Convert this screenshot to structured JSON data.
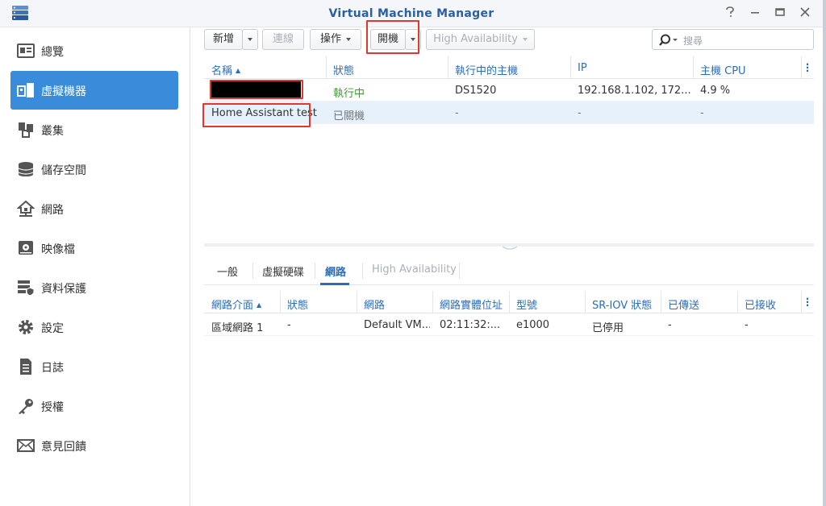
{
  "window": {
    "title": "Virtual Machine Manager"
  },
  "sidebar": {
    "items": [
      {
        "label": "總覽",
        "icon": "overview-icon"
      },
      {
        "label": "虛擬機器",
        "icon": "vm-icon",
        "active": true
      },
      {
        "label": "叢集",
        "icon": "cluster-icon"
      },
      {
        "label": "儲存空間",
        "icon": "storage-icon"
      },
      {
        "label": "網路",
        "icon": "network-icon"
      },
      {
        "label": "映像檔",
        "icon": "image-icon"
      },
      {
        "label": "資料保護",
        "icon": "protection-icon"
      },
      {
        "label": "設定",
        "icon": "gear-icon"
      },
      {
        "label": "日誌",
        "icon": "log-icon"
      },
      {
        "label": "授權",
        "icon": "key-icon"
      },
      {
        "label": "意見回饋",
        "icon": "mail-icon"
      }
    ]
  },
  "toolbar": {
    "create": "新增",
    "connect": "連線",
    "action": "操作",
    "power_on": "開機",
    "high_availability": "High Availability",
    "search_placeholder": "搜尋"
  },
  "vm_table": {
    "columns": [
      "名稱",
      "狀態",
      "執行中的主機",
      "IP",
      "主機 CPU"
    ],
    "rows": [
      {
        "name": "",
        "status": "執行中",
        "host": "DS1520",
        "ip": "192.168.1.102, 172....",
        "cpu": "4.9 %"
      },
      {
        "name": "Home Assistant test",
        "status": "已關機",
        "host": "-",
        "ip": "-",
        "cpu": "-"
      }
    ]
  },
  "detail_tabs": [
    "一般",
    "虛擬硬碟",
    "網路",
    "High Availability"
  ],
  "network_table": {
    "columns": [
      "網路介面",
      "狀態",
      "網路",
      "網路實體位址",
      "型號",
      "SR-IOV 狀態",
      "已傳送",
      "已接收"
    ],
    "rows": [
      {
        "interface": "區域網路 1",
        "status": "-",
        "network": "Default VM...",
        "mac": "02:11:32:...",
        "model": "e1000",
        "sriov": "已停用",
        "sent": "-",
        "received": "-"
      }
    ]
  },
  "colors": {
    "accent": "#3a8bd9",
    "link": "#2a6ebb",
    "running": "#3c9a2e",
    "highlight": "#e0392b"
  }
}
